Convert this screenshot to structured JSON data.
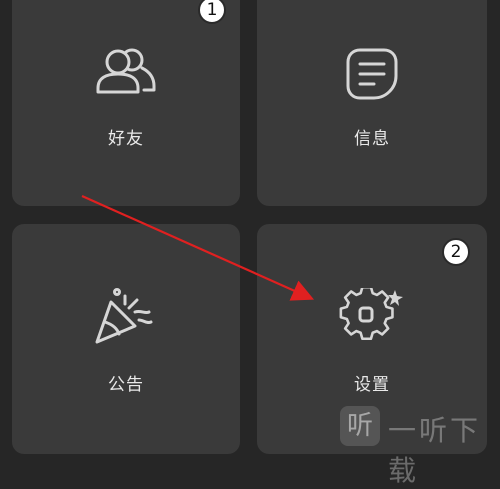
{
  "tiles": {
    "friends": {
      "label": "好友",
      "icon": "friends-icon"
    },
    "messages": {
      "label": "信息",
      "icon": "message-icon"
    },
    "announcements": {
      "label": "公告",
      "icon": "party-popper-icon"
    },
    "settings": {
      "label": "设置",
      "icon": "gear-icon"
    }
  },
  "badges": {
    "step1": "1",
    "step2": "2"
  },
  "watermark": {
    "logo": "听",
    "text": "一听下载"
  },
  "colors": {
    "background": "#262626",
    "tile": "#3a3a3a",
    "arrow": "#e02020",
    "icon_stroke": "#d6d6d6"
  }
}
